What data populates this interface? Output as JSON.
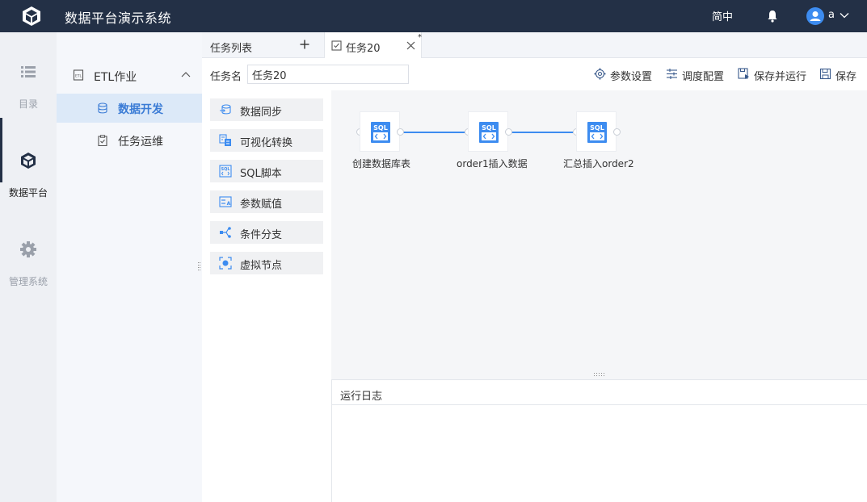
{
  "app": {
    "title": "数据平台演示系统"
  },
  "header": {
    "lang_label": "简中",
    "user_name": "a"
  },
  "rail": [
    {
      "label": "目录",
      "icon": "list-icon"
    },
    {
      "label": "数据平台",
      "icon": "cube-icon"
    },
    {
      "label": "管理系统",
      "icon": "gear-icon"
    }
  ],
  "menu": {
    "group_label": "ETL作业",
    "items": [
      {
        "label": "数据开发",
        "active": true
      },
      {
        "label": "任务运维",
        "active": false
      }
    ]
  },
  "tabs": {
    "list_label": "任务列表",
    "task_label": "任务20",
    "modified_marker": "*"
  },
  "toolbar": {
    "name_label": "任务名",
    "name_value": "任务20",
    "params_label": "参数设置",
    "schedule_label": "调度配置",
    "save_run_label": "保存并运行",
    "save_label": "保存"
  },
  "palette": [
    {
      "label": "数据同步",
      "icon": "sync-icon"
    },
    {
      "label": "可视化转换",
      "icon": "transform-icon"
    },
    {
      "label": "SQL脚本",
      "icon": "sql-icon"
    },
    {
      "label": "参数赋值",
      "icon": "param-assign-icon"
    },
    {
      "label": "条件分支",
      "icon": "branch-icon"
    },
    {
      "label": "虚拟节点",
      "icon": "virtual-node-icon"
    }
  ],
  "flow": {
    "nodes": [
      {
        "label": "创建数据库表",
        "type": "SQL"
      },
      {
        "label": "order1插入数据",
        "type": "SQL"
      },
      {
        "label": "汇总插入order2",
        "type": "SQL"
      }
    ],
    "sql_badge": "SQL"
  },
  "log": {
    "title": "运行日志"
  },
  "colors": {
    "header_bg": "#233046",
    "accent": "#3d8cf0",
    "menu_active_bg": "#dce9f8"
  }
}
